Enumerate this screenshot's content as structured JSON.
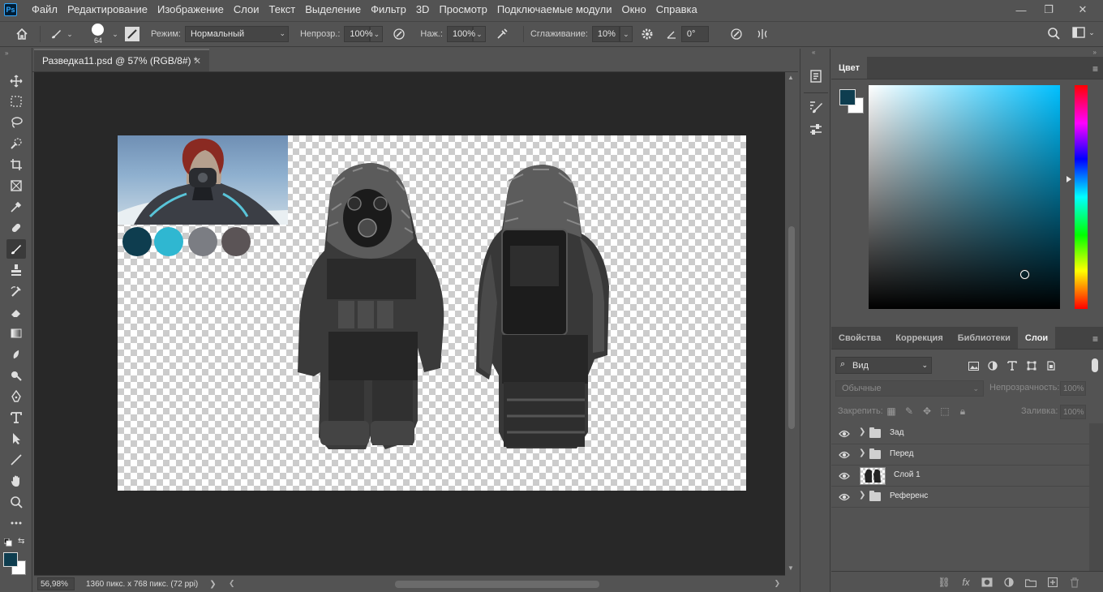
{
  "app": {
    "logo_text": "Ps"
  },
  "menu": [
    "Файл",
    "Редактирование",
    "Изображение",
    "Слои",
    "Текст",
    "Выделение",
    "Фильтр",
    "3D",
    "Просмотр",
    "Подключаемые модули",
    "Окно",
    "Справка"
  ],
  "window_controls": {
    "minimize": "—",
    "restore": "❐",
    "close": "✕"
  },
  "options": {
    "brush_size": "64",
    "mode_label": "Режим:",
    "mode_value": "Нормальный",
    "opacity_label": "Непрозр.:",
    "opacity_value": "100%",
    "flow_label": "Наж.:",
    "flow_value": "100%",
    "smoothing_label": "Сглаживание:",
    "smoothing_value": "10%",
    "angle_value": "0°"
  },
  "document": {
    "tab_title": "Разведка11.psd @ 57% (RGB/8#) *",
    "palette_colors": [
      "#0e3d4f",
      "#2fb7d1",
      "#7b7d83",
      "#5b5456"
    ]
  },
  "status": {
    "zoom": "56,98%",
    "info": "1360 пикс. x 768 пикс. (72 ppi)"
  },
  "color_panel": {
    "tab": "Цвет",
    "fg": "#0e3d4f",
    "bg": "#ffffff"
  },
  "layers_panel": {
    "tabs": [
      "Свойства",
      "Коррекция",
      "Библиотеки",
      "Слои"
    ],
    "active_tab": "Слои",
    "filter_label": "Вид",
    "blend_mode": "Обычные",
    "opacity_label": "Непрозрачность:",
    "opacity_value": "100%",
    "lock_label": "Закрепить:",
    "fill_label": "Заливка:",
    "fill_value": "100%",
    "layers": [
      {
        "name": "Зад",
        "type": "group"
      },
      {
        "name": "Перед",
        "type": "group"
      },
      {
        "name": "Слой 1",
        "type": "pixel"
      },
      {
        "name": "Референс",
        "type": "group"
      }
    ]
  }
}
